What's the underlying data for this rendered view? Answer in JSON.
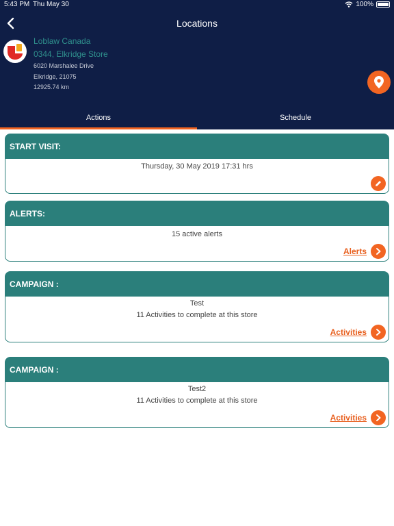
{
  "status_bar": {
    "time": "5:43 PM",
    "date": "Thu May 30",
    "battery": "100%"
  },
  "nav": {
    "title": "Locations"
  },
  "store": {
    "company": "Loblaw Canada",
    "name": "0344, Elkridge Store",
    "address_line1": "6020 Marshalee Drive",
    "address_line2": "Elkridge, 21075",
    "distance": "12925.74 km"
  },
  "tabs": [
    {
      "label": "Actions",
      "active": true
    },
    {
      "label": "Schedule",
      "active": false
    }
  ],
  "cards": {
    "start_visit": {
      "title": "START VISIT:",
      "line1": "Thursday, 30 May 2019 17:31 hrs"
    },
    "alerts": {
      "title": "ALERTS:",
      "line1": "15 active alerts",
      "link": "Alerts"
    },
    "campaign1": {
      "title": "CAMPAIGN :",
      "line1": "Test",
      "line2": "11 Activities to complete at this store",
      "link": "Activities"
    },
    "campaign2": {
      "title": "CAMPAIGN :",
      "line1": "Test2",
      "line2": "11 Activities to complete at this store",
      "link": "Activities"
    }
  },
  "colors": {
    "header_bg": "#0f1e46",
    "card_teal": "#2b7f7b",
    "accent_orange": "#f26522",
    "store_text": "#2f8f8c"
  },
  "icons": {
    "back": "chevron-left-icon",
    "location": "map-pin-icon",
    "edit": "pencil-icon",
    "go": "chevron-right-icon",
    "wifi": "wifi-icon",
    "battery": "battery-icon"
  }
}
